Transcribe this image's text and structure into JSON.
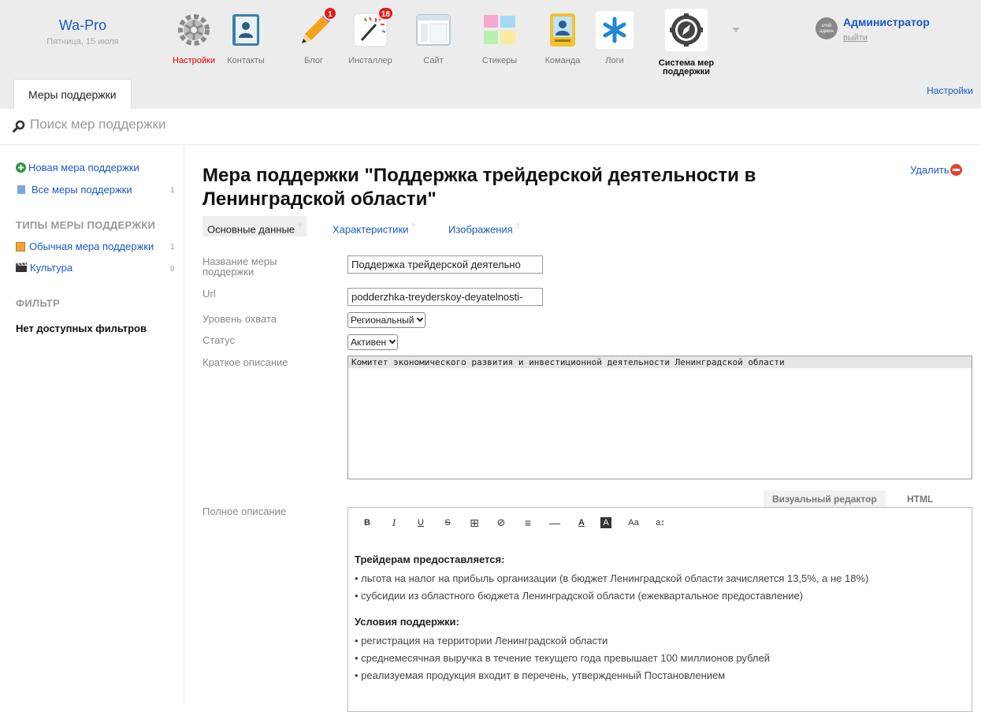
{
  "brand": {
    "name": "Wa-Pro",
    "date": "Пятница, 15 июля"
  },
  "apps": [
    {
      "label": "Настройки",
      "icon": "gear-icon",
      "active": true
    },
    {
      "label": "Контакты",
      "icon": "contacts-book-icon"
    },
    {
      "label": "Блог",
      "icon": "pencil-icon",
      "badge": "1"
    },
    {
      "label": "Инсталлер",
      "icon": "installer-wand-icon",
      "badge": "18"
    },
    {
      "label": "Сайт",
      "icon": "site-window-icon"
    },
    {
      "label": "Стикеры",
      "icon": "stickers-icon"
    },
    {
      "label": "Команда",
      "icon": "team-card-icon"
    },
    {
      "label": "Логи",
      "icon": "logs-asterisk-icon"
    },
    {
      "label": "Система мер поддержки",
      "icon": "compass-icon",
      "current": true
    }
  ],
  "user": {
    "avatar_text": "злой админ",
    "name": "Администратор",
    "logout": "выйти"
  },
  "main_tab": "Меры поддержки",
  "settings_link": "Настройки",
  "search": {
    "placeholder": "Поиск мер поддержки"
  },
  "sidebar": {
    "new_item": "Новая мера поддержки",
    "all_items": {
      "label": "Все меры поддержки",
      "count": "1"
    },
    "types_heading": "ТИПЫ МЕРЫ ПОДДЕРЖКИ",
    "types": [
      {
        "label": "Обычная мера поддержки",
        "count": "1"
      },
      {
        "label": "Культура",
        "count": "0"
      }
    ],
    "filter_heading": "ФИЛЬТР",
    "no_filters": "Нет доступных фильтров"
  },
  "page": {
    "title": "Мера поддержки \"Поддержка трейдерской деятельности в Ленинградской области\"",
    "delete_label": "Удалить"
  },
  "tabs": [
    {
      "label": "Основные данные",
      "active": true
    },
    {
      "label": "Характеристики"
    },
    {
      "label": "Изображения"
    }
  ],
  "tab_help_mark": "?",
  "form": {
    "name_label": "Название меры поддержки",
    "name_value": "Поддержка трейдерской деятельно",
    "url_label": "Url",
    "url_value": "podderzhka-treyderskoy-deyatelnosti-",
    "coverage_label": "Уровень охвата",
    "coverage_value": "Региональный",
    "status_label": "Статус",
    "status_value": "Активен",
    "short_desc_label": "Краткое описание",
    "short_desc_value": "Комитет экономического развития и инвестиционной деятельности Ленинградской области",
    "full_desc_label": "Полное описание"
  },
  "editor": {
    "tab_visual": "Визуальный редактор",
    "tab_html": "HTML",
    "toolbar": [
      "B",
      "I",
      "U",
      "S",
      "⊞",
      "⊘",
      "≡",
      "—",
      "A",
      "A",
      "Aa",
      "a↕"
    ],
    "heading1": "Трейдерам предоставляется:",
    "list1": [
      "• льгота на налог на прибыль организации (в бюджет Ленинградской области зачисляется 13,5%, а не 18%)",
      "• субсидии из областного бюджета Ленинградской области (ежеквартальное предоставление)"
    ],
    "heading2": "Условия поддержки:",
    "list2": [
      "• регистрация на территории Ленинградской области",
      "• среднемесячная выручка в течение текущего года превышает 100 миллионов рублей",
      "• реализуемая продукция входит в перечень, утвержденный Постановлением"
    ]
  }
}
